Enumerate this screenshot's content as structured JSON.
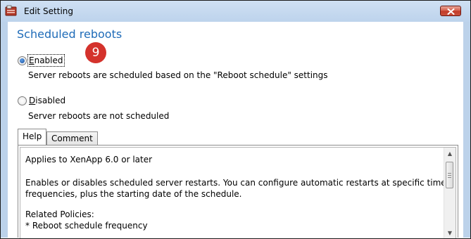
{
  "window": {
    "title": "Edit Setting",
    "close_icon": "close-x-icon",
    "app_icon": "settings-app-icon"
  },
  "setting": {
    "heading": "Scheduled reboots",
    "step_badge": "9"
  },
  "options": [
    {
      "label_first": "E",
      "label_rest": "nabled",
      "description": "Server reboots are scheduled based on the \"Reboot schedule\" settings",
      "selected": true
    },
    {
      "label_first": "D",
      "label_rest": "isabled",
      "description": "Server reboots are not scheduled",
      "selected": false
    }
  ],
  "tabs": [
    {
      "label": "Help",
      "active": true
    },
    {
      "label": "Comment",
      "active": false
    }
  ],
  "help_text": {
    "line1": "Applies to XenApp 6.0 or later",
    "line2": "Enables or disables scheduled server restarts. You can configure automatic restarts at specific times and",
    "line3": "frequencies, plus the starting date of the schedule.",
    "line4": "Related Policies:",
    "line5": "* Reboot schedule frequency"
  },
  "colors": {
    "heading": "#1e6bb8",
    "badge": "#d4322c",
    "titlebar": "#c5d9ef",
    "close_button": "#c9503c"
  }
}
